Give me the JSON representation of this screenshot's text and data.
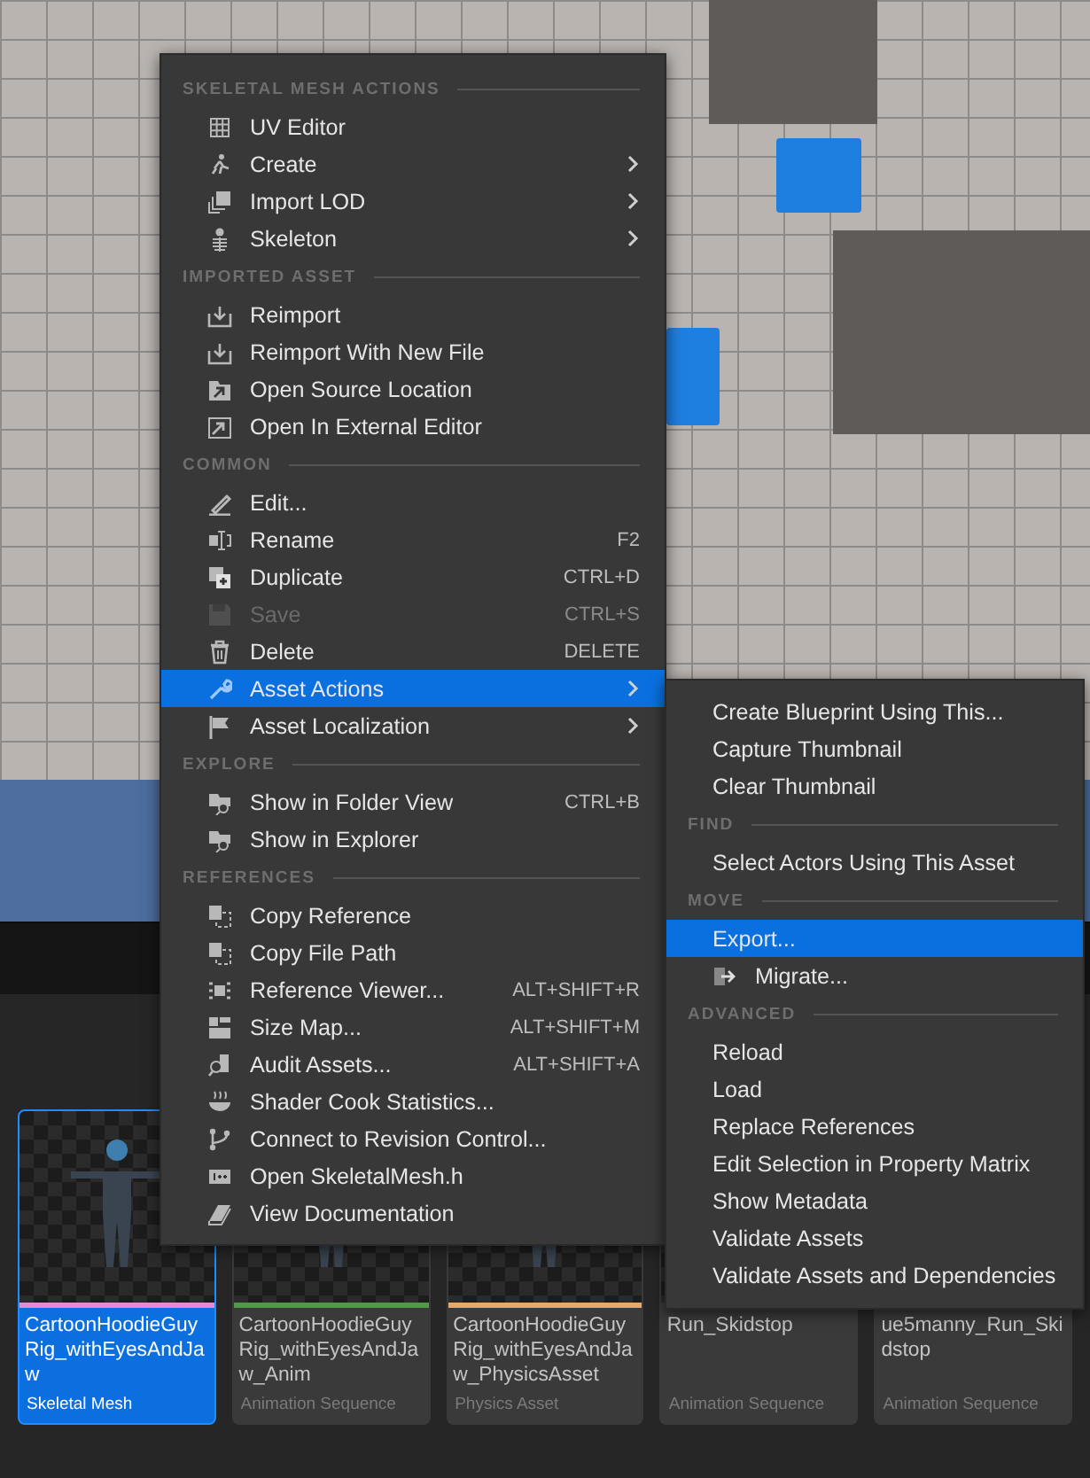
{
  "main_menu": {
    "sections": [
      {
        "header": "SKELETAL MESH ACTIONS",
        "items": [
          {
            "label": "UV Editor",
            "submenu": false,
            "disabled": false,
            "selected": false
          },
          {
            "label": "Create",
            "submenu": true,
            "disabled": false,
            "selected": false
          },
          {
            "label": "Import LOD",
            "submenu": true,
            "disabled": false,
            "selected": false
          },
          {
            "label": "Skeleton",
            "submenu": true,
            "disabled": false,
            "selected": false
          }
        ]
      },
      {
        "header": "IMPORTED ASSET",
        "items": [
          {
            "label": "Reimport",
            "submenu": false,
            "disabled": false,
            "selected": false
          },
          {
            "label": "Reimport With New File",
            "submenu": false,
            "disabled": false,
            "selected": false
          },
          {
            "label": "Open Source Location",
            "submenu": false,
            "disabled": false,
            "selected": false
          },
          {
            "label": "Open In External Editor",
            "submenu": false,
            "disabled": false,
            "selected": false
          }
        ]
      },
      {
        "header": "COMMON",
        "items": [
          {
            "label": "Edit...",
            "submenu": false,
            "disabled": false,
            "selected": false
          },
          {
            "label": "Rename",
            "shortcut": "F2",
            "submenu": false,
            "disabled": false,
            "selected": false
          },
          {
            "label": "Duplicate",
            "shortcut": "CTRL+D",
            "submenu": false,
            "disabled": false,
            "selected": false
          },
          {
            "label": "Save",
            "shortcut": "CTRL+S",
            "submenu": false,
            "disabled": true,
            "selected": false
          },
          {
            "label": "Delete",
            "shortcut": "DELETE",
            "submenu": false,
            "disabled": false,
            "selected": false
          },
          {
            "label": "Asset Actions",
            "submenu": true,
            "disabled": false,
            "selected": true
          },
          {
            "label": "Asset Localization",
            "submenu": true,
            "disabled": false,
            "selected": false
          }
        ]
      },
      {
        "header": "EXPLORE",
        "items": [
          {
            "label": "Show in Folder View",
            "shortcut": "CTRL+B",
            "submenu": false,
            "disabled": false,
            "selected": false
          },
          {
            "label": "Show in Explorer",
            "submenu": false,
            "disabled": false,
            "selected": false
          }
        ]
      },
      {
        "header": "REFERENCES",
        "items": [
          {
            "label": "Copy Reference",
            "submenu": false,
            "disabled": false,
            "selected": false
          },
          {
            "label": "Copy File Path",
            "submenu": false,
            "disabled": false,
            "selected": false
          },
          {
            "label": "Reference Viewer...",
            "shortcut": "ALT+SHIFT+R",
            "submenu": false,
            "disabled": false,
            "selected": false
          },
          {
            "label": "Size Map...",
            "shortcut": "ALT+SHIFT+M",
            "submenu": false,
            "disabled": false,
            "selected": false
          },
          {
            "label": "Audit Assets...",
            "shortcut": "ALT+SHIFT+A",
            "submenu": false,
            "disabled": false,
            "selected": false
          },
          {
            "label": "Shader Cook Statistics...",
            "submenu": false,
            "disabled": false,
            "selected": false
          },
          {
            "label": "Connect to Revision Control...",
            "submenu": false,
            "disabled": false,
            "selected": false
          },
          {
            "label": "Open SkeletalMesh.h",
            "submenu": false,
            "disabled": false,
            "selected": false
          },
          {
            "label": "View Documentation",
            "submenu": false,
            "disabled": false,
            "selected": false
          }
        ]
      }
    ]
  },
  "asset_actions_submenu": {
    "sections": [
      {
        "items": [
          {
            "label": "Create Blueprint Using This...",
            "selected": false
          },
          {
            "label": "Capture Thumbnail",
            "selected": false
          },
          {
            "label": "Clear Thumbnail",
            "selected": false
          }
        ]
      },
      {
        "header": "FIND",
        "items": [
          {
            "label": "Select Actors Using This Asset",
            "selected": false
          }
        ]
      },
      {
        "header": "MOVE",
        "items": [
          {
            "label": "Export...",
            "selected": true
          },
          {
            "label": "Migrate...",
            "selected": false
          }
        ]
      },
      {
        "header": "ADVANCED",
        "items": [
          {
            "label": "Reload",
            "selected": false
          },
          {
            "label": "Load",
            "selected": false
          },
          {
            "label": "Replace References",
            "selected": false
          },
          {
            "label": "Edit Selection in Property Matrix",
            "selected": false
          },
          {
            "label": "Show Metadata",
            "selected": false
          },
          {
            "label": "Validate Assets",
            "selected": false
          },
          {
            "label": "Validate Assets and Dependencies",
            "selected": false
          }
        ]
      }
    ]
  },
  "assets": [
    {
      "name": "CartoonHoodieGuyRig_withEyesAndJaw",
      "type": "Skeletal Mesh",
      "color": "#e58ad6",
      "selected": true
    },
    {
      "name": "CartoonHoodieGuyRig_withEyesAndJaw_Anim",
      "type": "Animation Sequence",
      "color": "#4f9a45",
      "selected": false
    },
    {
      "name": "CartoonHoodieGuyRig_withEyesAndJaw_PhysicsAsset",
      "type": "Physics Asset",
      "color": "#e8a868",
      "selected": false
    },
    {
      "name": "Run_Skidstop",
      "type": "Animation Sequence",
      "selected": false
    },
    {
      "name": "ue5manny_Run_Skidstop",
      "type": "Animation Sequence",
      "selected": false
    }
  ]
}
